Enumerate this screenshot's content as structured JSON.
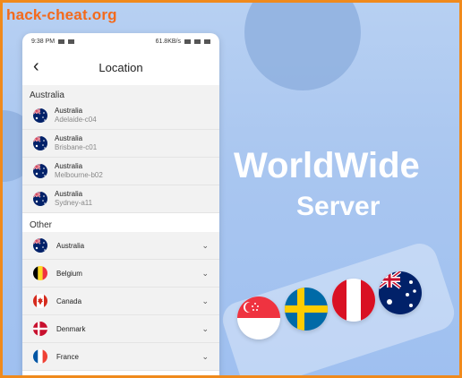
{
  "watermark": "hack-cheat.org",
  "promo": {
    "line1": "WorldWide",
    "line2": "Server"
  },
  "status_bar": {
    "time": "9:38 PM",
    "speed": "61.8KB/s"
  },
  "page": {
    "title": "Location",
    "back_icon": "chevron-left-icon"
  },
  "sections": {
    "australia_label": "Australia",
    "other_label": "Other"
  },
  "australia_servers": [
    {
      "country": "Australia",
      "server": "Adelaide-c04"
    },
    {
      "country": "Australia",
      "server": "Brisbane-c01"
    },
    {
      "country": "Australia",
      "server": "Melbourne-b02"
    },
    {
      "country": "Australia",
      "server": "Sydney-a11"
    }
  ],
  "other_countries": [
    {
      "name": "Australia"
    },
    {
      "name": "Belgium"
    },
    {
      "name": "Canada"
    },
    {
      "name": "Denmark"
    },
    {
      "name": "France"
    }
  ],
  "colors": {
    "border": "#f08a1c",
    "watermark": "#f36a1c",
    "background": "#a9c6f0"
  }
}
